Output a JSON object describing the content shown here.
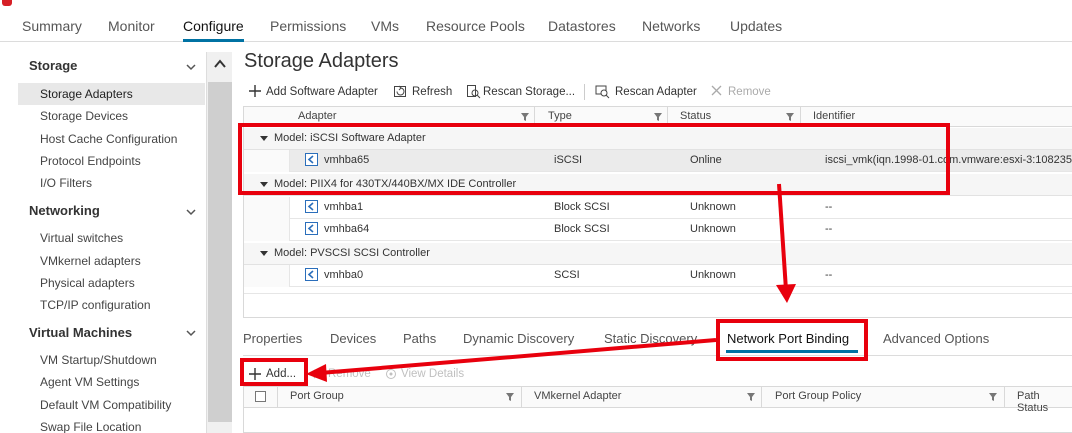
{
  "top_tabs": [
    {
      "label": "Summary"
    },
    {
      "label": "Monitor"
    },
    {
      "label": "Configure",
      "active": true
    },
    {
      "label": "Permissions"
    },
    {
      "label": "VMs"
    },
    {
      "label": "Resource Pools"
    },
    {
      "label": "Datastores"
    },
    {
      "label": "Networks"
    },
    {
      "label": "Updates"
    }
  ],
  "sidebar": {
    "sections": [
      {
        "title": "Storage",
        "items": [
          "Storage Adapters",
          "Storage Devices",
          "Host Cache Configuration",
          "Protocol Endpoints",
          "I/O Filters"
        ]
      },
      {
        "title": "Networking",
        "items": [
          "Virtual switches",
          "VMkernel adapters",
          "Physical adapters",
          "TCP/IP configuration"
        ]
      },
      {
        "title": "Virtual Machines",
        "items": [
          "VM Startup/Shutdown",
          "Agent VM Settings",
          "Default VM Compatibility",
          "Swap File Location"
        ]
      }
    ],
    "active_item": "Storage Adapters"
  },
  "main": {
    "title": "Storage Adapters",
    "toolbar": {
      "add_software_adapter": "Add Software Adapter",
      "refresh": "Refresh",
      "rescan_storage": "Rescan Storage...",
      "rescan_adapter": "Rescan Adapter",
      "remove": "Remove"
    },
    "table": {
      "columns": [
        "Adapter",
        "Type",
        "Status",
        "Identifier"
      ],
      "groups": [
        {
          "label": "Model: iSCSI Software Adapter",
          "rows": [
            {
              "adapter": "vmhba65",
              "type": "iSCSI",
              "status": "Online",
              "identifier": "iscsi_vmk(iqn.1998-01.com.vmware:esxi-3:108235",
              "selected": true
            }
          ]
        },
        {
          "label": "Model: PIIX4 for 430TX/440BX/MX IDE Controller",
          "rows": [
            {
              "adapter": "vmhba1",
              "type": "Block SCSI",
              "status": "Unknown",
              "identifier": "--"
            },
            {
              "adapter": "vmhba64",
              "type": "Block SCSI",
              "status": "Unknown",
              "identifier": "--"
            }
          ]
        },
        {
          "label": "Model: PVSCSI SCSI Controller",
          "rows": [
            {
              "adapter": "vmhba0",
              "type": "SCSI",
              "status": "Unknown",
              "identifier": "--"
            }
          ]
        }
      ]
    },
    "detail_tabs": [
      "Properties",
      "Devices",
      "Paths",
      "Dynamic Discovery",
      "Static Discovery",
      "Network Port Binding",
      "Advanced Options"
    ],
    "active_detail_tab": "Network Port Binding",
    "binding_toolbar": {
      "add": "Add...",
      "remove": "Remove",
      "view_details": "View Details"
    },
    "binding_columns": [
      "Port Group",
      "VMkernel Adapter",
      "Port Group Policy",
      "Path Status"
    ]
  },
  "colors": {
    "accent": "#0072a3",
    "annotation": "#e8000d"
  }
}
